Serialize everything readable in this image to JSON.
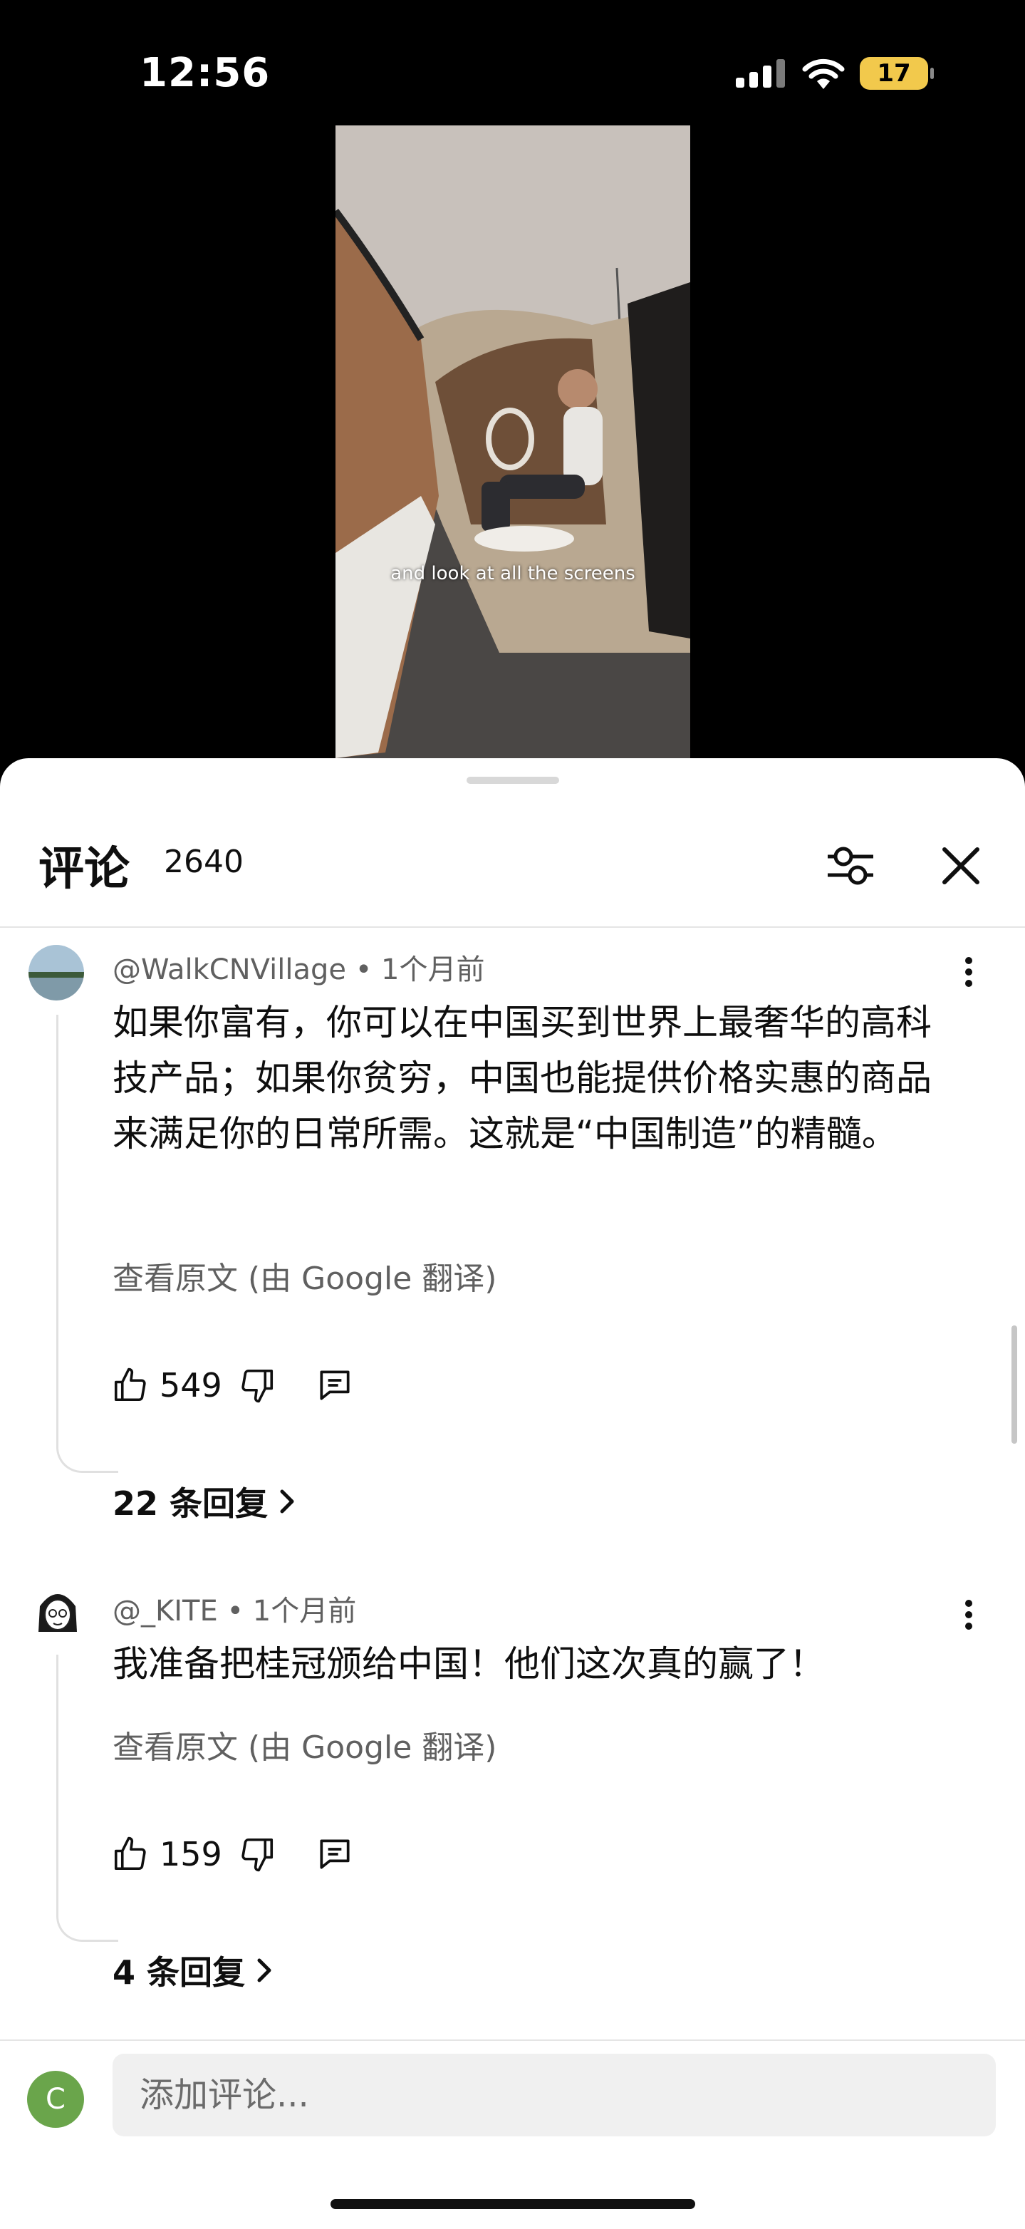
{
  "status_bar": {
    "time": "12:56",
    "battery": "17"
  },
  "video": {
    "caption": "and look at all the screens"
  },
  "comments_panel": {
    "title": "评论",
    "count": "2640",
    "comments": [
      {
        "author": "@WalkCNVillage",
        "time": "1个月前",
        "text": "如果你富有，你可以在中国买到世界上最奢华的高科技产品；如果你贫穷，中国也能提供价格实惠的商品来满足你的日常所需。这就是“中国制造”的精髓。",
        "translate_link": "查看原文 (由 Google 翻译)",
        "likes": "549",
        "replies": "22 条回复"
      },
      {
        "author": "@_KITE",
        "time": "1个月前",
        "text": "我准备把桂冠颁给中国！他们这次真的赢了！",
        "translate_link": "查看原文 (由 Google 翻译)",
        "likes": "159",
        "replies": "4 条回复"
      }
    ],
    "input": {
      "avatar_letter": "C",
      "placeholder": "添加评论..."
    }
  },
  "colors": {
    "accent_avatar": "#6aa54b",
    "battery": "#f2c94c",
    "muted_text": "#606060"
  },
  "icons": [
    "signal-icon",
    "wifi-icon",
    "filter-icon",
    "close-icon",
    "more-icon",
    "thumb-up-icon",
    "thumb-down-icon",
    "reply-icon",
    "chevron-right-icon"
  ]
}
